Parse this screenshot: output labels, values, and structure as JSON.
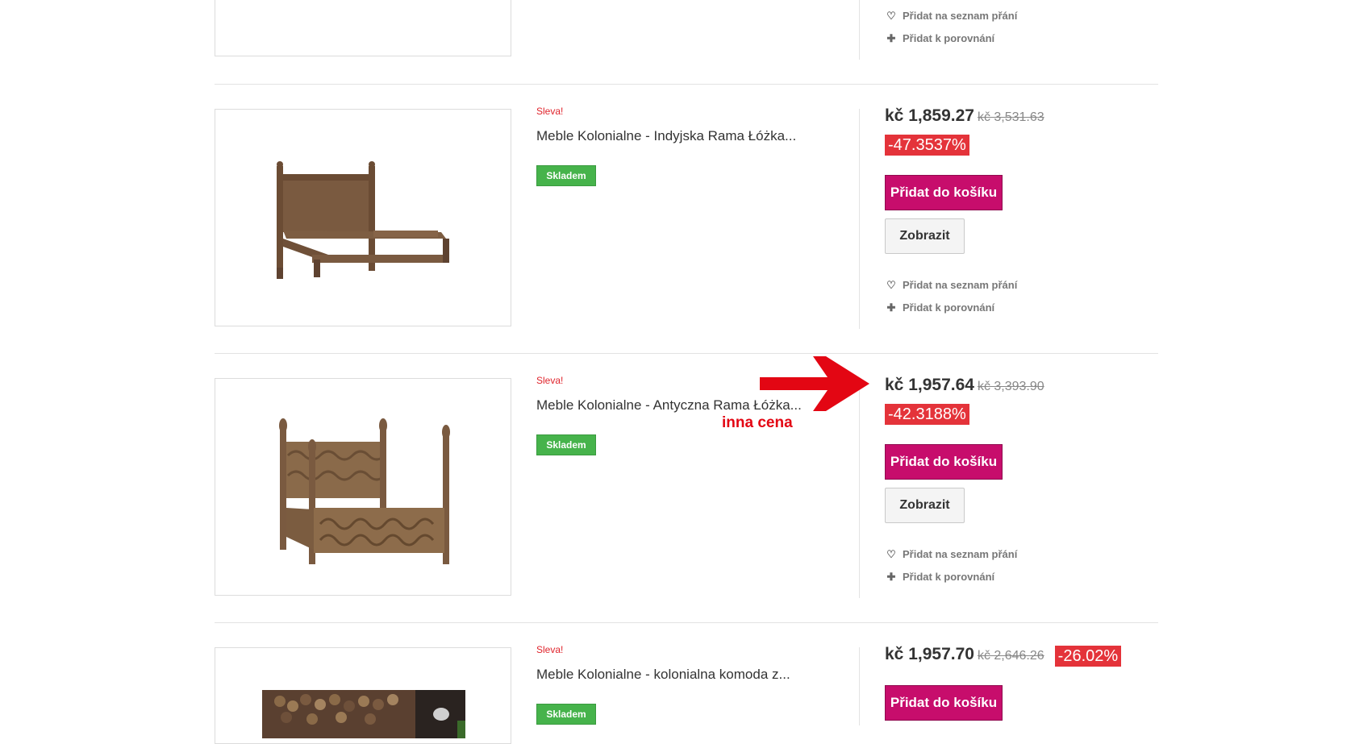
{
  "colors": {
    "sale_red": "#e0242c",
    "stock_green": "#46b34b",
    "cart_magenta": "#c70d6c",
    "discount_red": "#e4333a",
    "annotation_red": "#e30613"
  },
  "top_partial": {
    "wishlist_label": "Přidat na seznam přání",
    "compare_label": "Přidat k porovnání"
  },
  "products": [
    {
      "sale_label": "Sleva!",
      "title": "Meble Kolonialne - Indyjska Rama Łóżka...",
      "stock": "Skladem",
      "price": "kč 1,859.27",
      "old_price": "kč 3,531.63",
      "discount": "-47.3537%",
      "cart_label": "Přidat do košíku",
      "view_label": "Zobrazit",
      "wishlist_label": "Přidat na seznam přání",
      "compare_label": "Přidat k porovnání"
    },
    {
      "sale_label": "Sleva!",
      "title": "Meble Kolonialne - Antyczna Rama Łóżka...",
      "stock": "Skladem",
      "price": "kč 1,957.64",
      "old_price": "kč 3,393.90",
      "discount": "-42.3188%",
      "cart_label": "Přidat do košíku",
      "view_label": "Zobrazit",
      "wishlist_label": "Přidat na seznam přání",
      "compare_label": "Přidat k porovnání"
    },
    {
      "sale_label": "Sleva!",
      "title": "Meble Kolonialne - kolonialna komoda z...",
      "stock": "Skladem",
      "price": "kč 1,957.70",
      "old_price": "kč 2,646.26",
      "discount": "-26.02%",
      "cart_label": "Přidat do košíku"
    }
  ],
  "annotation": {
    "text": "inna cena",
    "icon": "arrow-right-icon"
  }
}
